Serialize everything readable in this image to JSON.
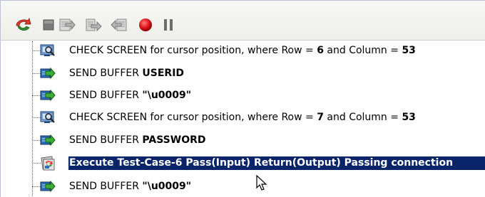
{
  "toolbar": {
    "buttons": [
      {
        "name": "run-icon",
        "color": "#e23a2e"
      },
      {
        "name": "stop-icon",
        "color": "#777777"
      },
      {
        "name": "step-into-icon",
        "color": "#8a8a8a"
      },
      {
        "name": "step-over-icon",
        "color": "#8a8a8a"
      },
      {
        "name": "step-out-icon",
        "color": "#8a8a8a"
      },
      {
        "name": "record-icon",
        "color": "#e0141a"
      },
      {
        "name": "pause-icon",
        "color": "#6d6d6d"
      }
    ]
  },
  "tree": {
    "rows": [
      {
        "icon": "check-screen-icon",
        "prefix": "CHECK SCREEN for cursor position, where Row = ",
        "b1": "6",
        "mid": " and Column = ",
        "b2": "53",
        "selected": false
      },
      {
        "icon": "send-buffer-icon",
        "prefix": "SEND BUFFER ",
        "b1": "USERID",
        "selected": false
      },
      {
        "icon": "send-buffer-icon",
        "prefix": "SEND BUFFER ",
        "b1": "\"\\u0009\"",
        "selected": false
      },
      {
        "icon": "check-screen-icon",
        "prefix": "CHECK SCREEN for cursor position, where Row = ",
        "b1": "7",
        "mid": " and Column = ",
        "b2": "53",
        "selected": false
      },
      {
        "icon": "send-buffer-icon",
        "prefix": "SEND BUFFER ",
        "b1": "PASSWORD",
        "selected": false
      },
      {
        "icon": "execute-test-case-icon",
        "text": "Execute Test-Case-6 Pass(Input) Return(Output) Passing connection",
        "selected": true
      },
      {
        "icon": "send-buffer-icon",
        "prefix": "SEND BUFFER ",
        "b1": "\"\\u0009\"",
        "selected": false
      }
    ]
  },
  "colors": {
    "selection_bg": "#0a246a",
    "selection_fg": "#ffffff"
  },
  "cursor": {
    "icon": "mouse-pointer-icon"
  }
}
